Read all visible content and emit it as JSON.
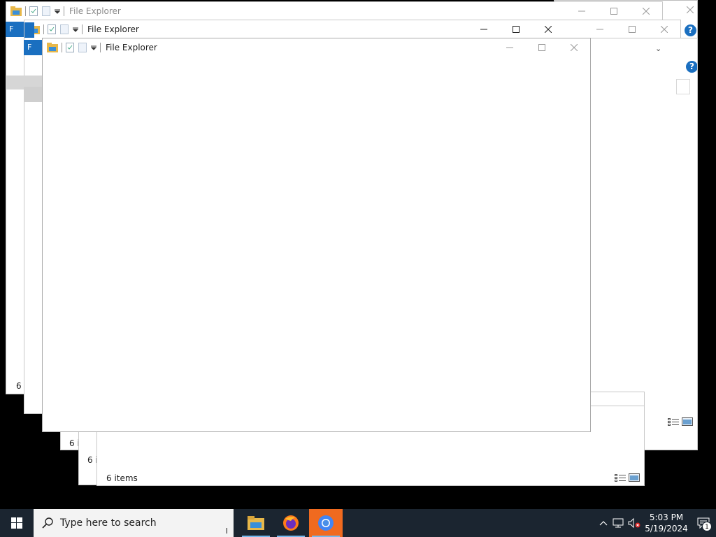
{
  "windows": {
    "back1": {
      "title": "File Explorer",
      "status": "6 i"
    },
    "back2": {
      "title": "File Explorer",
      "ribbon_tab": "F",
      "status": "6 i"
    },
    "back3": {
      "ribbon_tab": "F",
      "status": "6 i"
    },
    "back4": {
      "status": "6 items"
    },
    "front": {
      "title": "File Explorer"
    },
    "help_label": "?",
    "close_glyph": "✕"
  },
  "taskbar": {
    "search_placeholder": "Type here to search",
    "apps": [
      "file-explorer",
      "firefox",
      "chrome"
    ],
    "clock_time": "5:03 PM",
    "clock_date": "5/19/2024",
    "notification_count": "1"
  },
  "colors": {
    "accent": "#1a6fc0",
    "taskbar": "#1b2530",
    "active_app": "#f06a1f"
  }
}
